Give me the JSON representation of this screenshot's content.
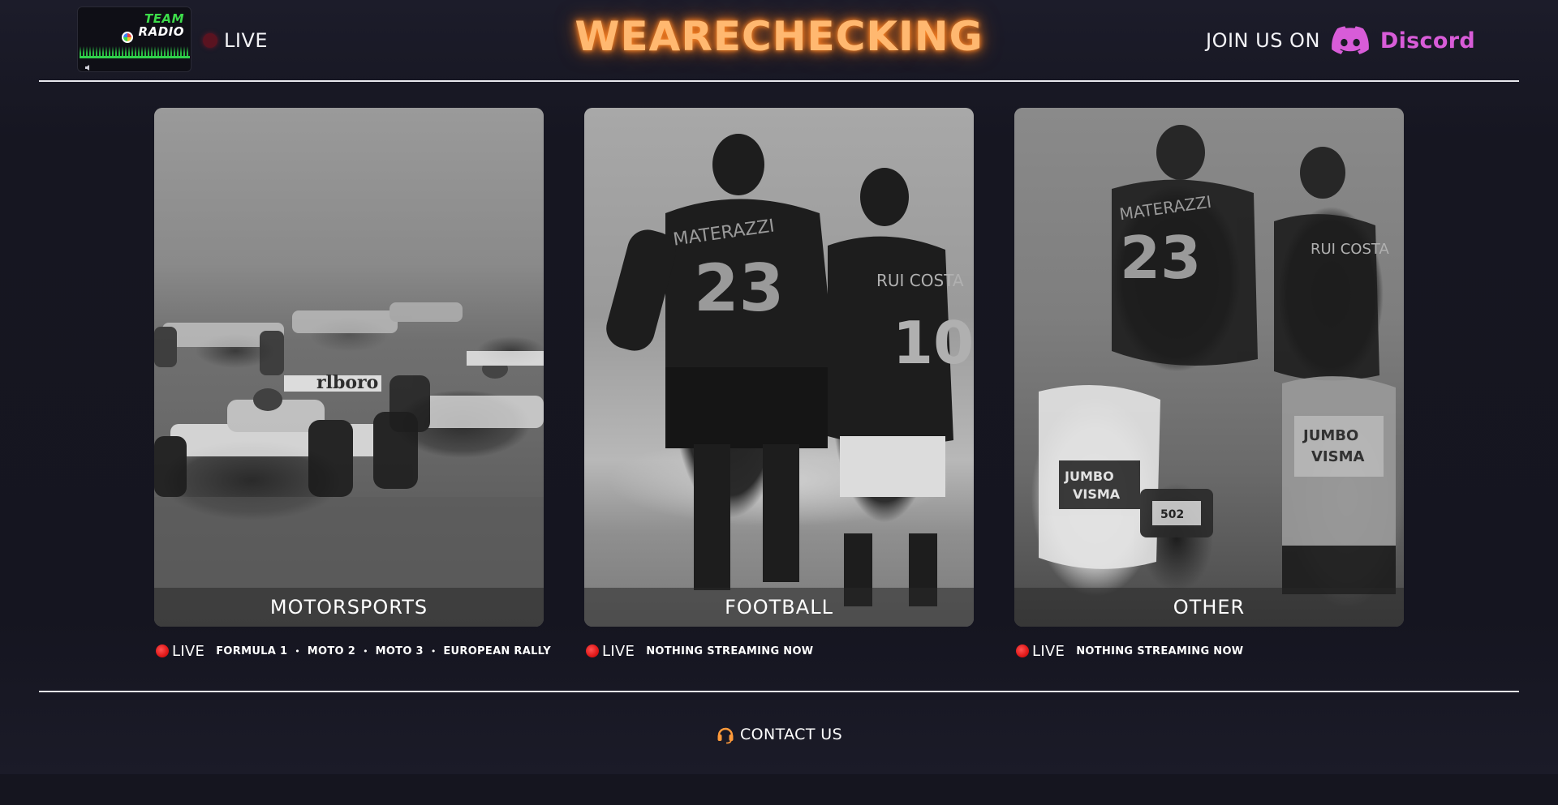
{
  "header": {
    "radio_widget": {
      "logo_line1": "TEAM",
      "logo_line2": "RADIO",
      "volume_icon": "volume-icon"
    },
    "live_label": "LIVE",
    "brand": "WEARECHECKING",
    "join_label": "JOIN US ON",
    "discord_label": "Discord"
  },
  "cards": [
    {
      "caption": "MOTORSPORTS",
      "image": "formula-one-cars-photo"
    },
    {
      "caption": "FOOTBALL",
      "image": "football-players-photo",
      "jersey_names": [
        "MATERAZZI",
        "RUI COSTA"
      ],
      "jersey_numbers": [
        "23",
        "10"
      ]
    },
    {
      "caption": "OTHER",
      "image": "collage-football-cycling-photo"
    }
  ],
  "status_rows": [
    {
      "live": "LIVE",
      "items": [
        "FORMULA 1",
        "MOTO 2",
        "MOTO 3",
        "EUROPEAN RALLY"
      ]
    },
    {
      "live": "LIVE",
      "items": [
        "NOTHING STREAMING NOW"
      ]
    },
    {
      "live": "LIVE",
      "items": [
        "NOTHING STREAMING NOW"
      ]
    }
  ],
  "footer": {
    "contact_label": "CONTACT US"
  },
  "colors": {
    "background": "#15151f",
    "brand_glow": "#ff8a2a",
    "discord": "#d85cd8",
    "live_red": "#e01818",
    "radio_green": "#3ddc4a"
  }
}
